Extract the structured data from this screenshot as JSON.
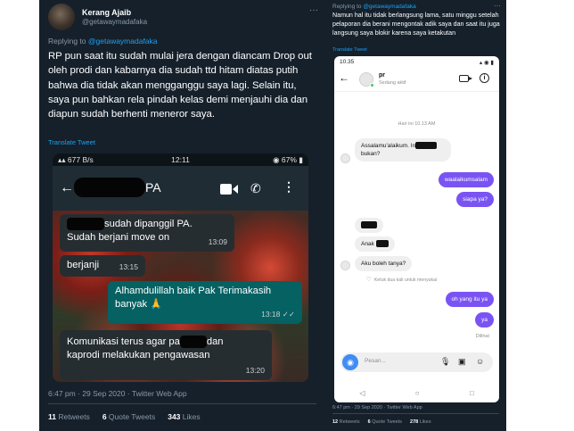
{
  "left_tweet": {
    "display_name": "Kerang Ajaib",
    "handle": "@getawaymadafaka",
    "replying_prefix": "Replying to ",
    "replying_to": "@getawaymadafaka",
    "more": "···",
    "body": "RP pun saat itu sudah mulai jera dengan diancam Drop out oleh prodi dan kabarnya dia sudah ttd hitam diatas putih bahwa dia tidak akan mengganggu saya lagi. Selain itu, saya pun bahkan rela pindah kelas demi menjauhi dia dan diapun sudah berhenti meneror saya.",
    "translate": "Translate Tweet",
    "timestamp": "6:47 pm · 29 Sep 2020 · Twitter Web App",
    "stats": {
      "retweets_count": "11",
      "retweets_label": "Retweets",
      "quotes_count": "6",
      "quotes_label": "Quote Tweets",
      "likes_count": "343",
      "likes_label": "Likes"
    },
    "whatsapp": {
      "status_signal": "▴▴ 677 B/s",
      "status_time": "12:11",
      "status_battery": "◉ 67% ▮",
      "back": "←",
      "contact_suffix": "PA",
      "call_icon": "✆",
      "menu_icon": "⋮",
      "messages": [
        {
          "line1_suffix": "sudah dipanggil PA.",
          "line2": "Sudah berjani move on",
          "time": "13:09"
        },
        {
          "text": "berjanji",
          "time": "13:15"
        },
        {
          "line1": "Alhamdulillah baik Pak Terimakasih",
          "line2": "banyak 🙏",
          "time": "13:18 ✓✓"
        },
        {
          "line1_prefix": "Komunikasi terus agar pa",
          "line1_suffix": "dan",
          "line2": "kaprodi melakukan pengawasan",
          "time": "13:20"
        }
      ]
    }
  },
  "right_tweet": {
    "replying_prefix": "Replying to ",
    "replying_to": "@getawaymadafaka",
    "more": "···",
    "body": "Namun hal itu tidak berlangsung lama, satu minggu setelah pelaporan dia berani mengontak adik saya dan saat itu juga langsung saya blokir karena saya ketakutan",
    "translate": "Translate Tweet",
    "timestamp": "6:47 pm · 29 Sep 2020 · Twitter Web App",
    "stats": {
      "retweets_count": "12",
      "retweets_label": "Retweets",
      "quotes_count": "6",
      "quotes_label": "Quote Tweets",
      "likes_count": "278",
      "likes_label": "Likes"
    },
    "instagram": {
      "status_time": "10.35",
      "status_right": "▴ ◉ ▮",
      "back": "←",
      "username": "pr",
      "active": "Sedang aktif",
      "info": "i",
      "date_divider": "Hari ini 10.13 AM",
      "msg_greeting_prefix": "Assalamu'alaikum. In",
      "msg_greeting_line2": "bukan?",
      "reply_1": "waalaikumsalam",
      "reply_2": "siapa ya?",
      "msg_anak": "Anak",
      "msg_ask": "Aku boleh tanya?",
      "like_hint": "Ketuk dua kali untuk menyukai",
      "reply_3": "oh yang itu ya",
      "reply_4": "ya",
      "seen": "Dilihat",
      "placeholder": "Pesan...",
      "nav_back": "◁",
      "nav_home": "○",
      "nav_recent": "□"
    }
  }
}
